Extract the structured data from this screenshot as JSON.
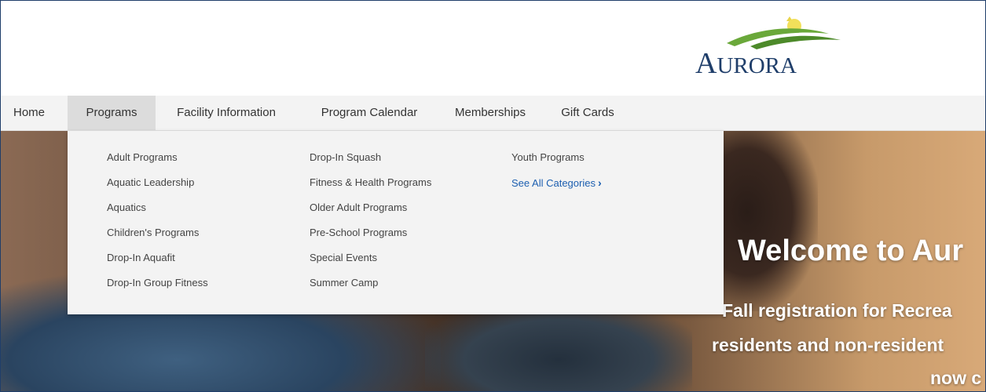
{
  "logo": {
    "text_big1": "A",
    "text_small": "URORA",
    "text_big2": ""
  },
  "nav": {
    "items": [
      {
        "label": "Home"
      },
      {
        "label": "Programs"
      },
      {
        "label": "Facility Information"
      },
      {
        "label": "Program Calendar"
      },
      {
        "label": "Memberships"
      },
      {
        "label": "Gift Cards"
      }
    ],
    "active": "Programs"
  },
  "dropdown": {
    "col1": [
      "Adult Programs",
      "Aquatic Leadership",
      "Aquatics",
      "Children's Programs",
      "Drop-In Aquafit",
      "Drop-In Group Fitness"
    ],
    "col2": [
      "Drop-In Squash",
      "Fitness & Health Programs",
      "Older Adult Programs",
      "Pre-School Programs",
      "Special Events",
      "Summer Camp"
    ],
    "col3": [
      "Youth Programs"
    ],
    "see_all": "See All Categories",
    "chevron": "›"
  },
  "hero": {
    "title": "Welcome to Aur",
    "line1": "Fall registration for Recrea",
    "line2": "residents and non-resident",
    "line3": "now c"
  },
  "colors": {
    "brand_navy": "#1f3e6a",
    "link_blue": "#1c5fb0",
    "logo_green": "#6aa83a",
    "logo_yellow": "#e8d44a"
  }
}
